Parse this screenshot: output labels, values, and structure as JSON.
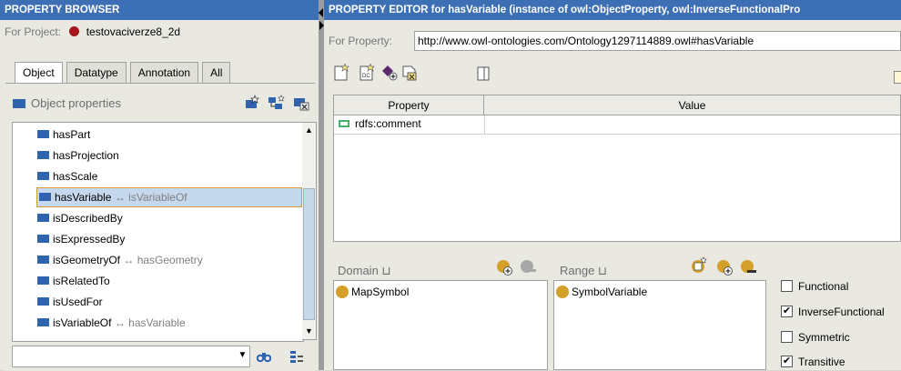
{
  "browser": {
    "title": "PROPERTY BROWSER",
    "project_label": "For Project:",
    "project_name": "testovaciverze8_2d",
    "tabs": [
      {
        "label": "Object"
      },
      {
        "label": "Datatype"
      },
      {
        "label": "Annotation"
      },
      {
        "label": "All"
      }
    ],
    "section_title": "Object properties",
    "items": [
      {
        "label": "hasPart",
        "inverse": ""
      },
      {
        "label": "hasProjection",
        "inverse": ""
      },
      {
        "label": "hasScale",
        "inverse": ""
      },
      {
        "label": "hasVariable",
        "inverse": "↔ isVariableOf"
      },
      {
        "label": "isDescribedBy",
        "inverse": ""
      },
      {
        "label": "isExpressedBy",
        "inverse": ""
      },
      {
        "label": "isGeometryOf",
        "inverse": "↔ hasGeometry"
      },
      {
        "label": "isRelatedTo",
        "inverse": ""
      },
      {
        "label": "isUsedFor",
        "inverse": ""
      },
      {
        "label": "isVariableOf",
        "inverse": "↔ hasVariable"
      }
    ],
    "selected_index": 3,
    "search_value": ""
  },
  "editor": {
    "title": "PROPERTY EDITOR for hasVariable   (instance of owl:ObjectProperty, owl:InverseFunctionalPro",
    "property_label": "For Property:",
    "property_uri": "http://www.owl-ontologies.com/Ontology1297114889.owl#hasVariable",
    "table": {
      "headers": [
        "Property",
        "Value"
      ],
      "rows": [
        {
          "property": "rdfs:comment",
          "value": ""
        }
      ]
    },
    "domain_label": "Domain ⊔",
    "domain_items": [
      "MapSymbol"
    ],
    "range_label": "Range ⊔",
    "range_items": [
      "SymbolVariable"
    ],
    "characteristics": [
      {
        "label": "Functional",
        "checked": false
      },
      {
        "label": "InverseFunctional",
        "checked": true
      },
      {
        "label": "Symmetric",
        "checked": false
      },
      {
        "label": "Transitive",
        "checked": true
      }
    ]
  },
  "colors": {
    "title_bar": "#3d6fb5",
    "selection": "#c5d8ee",
    "class_icon": "#d4a02a",
    "property_icon": "#2f63ae"
  }
}
